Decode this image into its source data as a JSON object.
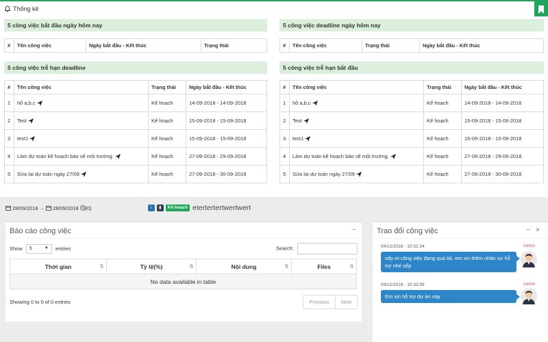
{
  "header": {
    "title": "Thống kê"
  },
  "panels": {
    "start_today": {
      "title": "5 công việc bắt đầu ngày hôm nay",
      "columns": [
        "#",
        "Tên công việc",
        "Ngày bắt đầu - Kết thúc",
        "Trạng thái"
      ]
    },
    "deadline_today": {
      "title": "5 công việc deadline ngày hôm nay",
      "columns": [
        "#",
        "Tên công việc",
        "Trạng thái",
        "Ngày bắt đầu - Kết thúc"
      ]
    },
    "overdue_deadline": {
      "title": "5 công việc trễ hạn deadline",
      "columns": [
        "#",
        "Tên công việc",
        "Trạng thái",
        "Ngày bắt đầu - Kết thúc"
      ],
      "rows": [
        {
          "num": "1",
          "name": "hồ a,b,c",
          "status": "Kế hoạch",
          "dates": "14-09-2018 - 14-09-2018"
        },
        {
          "num": "2",
          "name": "Test",
          "status": "Kế hoạch",
          "dates": "15-09-2018 - 15-09-2018"
        },
        {
          "num": "3",
          "name": "test1",
          "status": "Kế hoạch",
          "dates": "15-09-2018 - 15-09-2018"
        },
        {
          "num": "4",
          "name": "Làm dự toán kế hoạch bảo vệ môi trường.",
          "status": "Kế hoạch",
          "dates": "27-09-2018 - 29-09-2018"
        },
        {
          "num": "5",
          "name": "Sửa lại dự toán ngày 27/09",
          "status": "Kế hoạch",
          "dates": "27-09-2018 - 30-09-2018"
        }
      ]
    },
    "overdue_start": {
      "title": "5 công việc trễ hạn bắt đầu",
      "columns": [
        "#",
        "Tên công việc",
        "Trạng thái",
        "Ngày bắt đầu - Kết thúc"
      ],
      "rows": [
        {
          "num": "1",
          "name": "hồ a,b,c",
          "status": "Kế hoạch",
          "dates": "14-09-2018 - 14-09-2018"
        },
        {
          "num": "2",
          "name": "Test",
          "status": "Kế hoạch",
          "dates": "15-09-2018 - 15-09-2018"
        },
        {
          "num": "3",
          "name": "test1",
          "status": "Kế hoạch",
          "dates": "15-09-2018 - 15-09-2018"
        },
        {
          "num": "4",
          "name": "Làm dự toán kế hoạch bảo vệ môi trường.",
          "status": "Kế hoạch",
          "dates": "27-09-2018 - 29-09-2018"
        },
        {
          "num": "5",
          "name": "Sửa lại dự toán ngày 27/09",
          "status": "Kế hoạch",
          "dates": "27-09-2018 - 30-09-2018"
        }
      ]
    }
  },
  "filter": {
    "date_from": "28/09/2018",
    "arrow": "→",
    "date_to": "28/09/2018",
    "count": "(0)",
    "info_btn": "i",
    "chart_btn": "▮",
    "status_badge": "Kế hoạch",
    "task_title": "etertertertwertwert"
  },
  "report": {
    "title": "Báo cáo công việc",
    "collapse": "−",
    "show_label": "Show",
    "entries_value": "5",
    "entries_label": "entries",
    "search_label": "Search:",
    "search_placeholder": "",
    "columns": [
      "Thời gian",
      "Tỷ lệ(%)",
      "Nội dung",
      "Files"
    ],
    "empty": "No data available in table",
    "info": "Showing 0 to 0 of 0 entries",
    "prev": "Previous",
    "next": "Next"
  },
  "chat": {
    "title": "Trao đổi công việc",
    "minimize": "−",
    "close": "×",
    "messages": [
      {
        "time": "04/12/2018 - 10:32:34",
        "author": "Admin",
        "text": "sếp ơi công việc đang quá tải, em xin thêm nhân sự hỗ trợ nhé sếp"
      },
      {
        "time": "04/12/2018 - 10:32:59",
        "author": "Admin",
        "text": "Em xin hỗ trợ dự án này"
      }
    ]
  },
  "colors": {
    "accent": "#1fa65a",
    "panel_header": "#dcefdc",
    "bubble": "#2e86c8",
    "admin": "#d9534f"
  }
}
